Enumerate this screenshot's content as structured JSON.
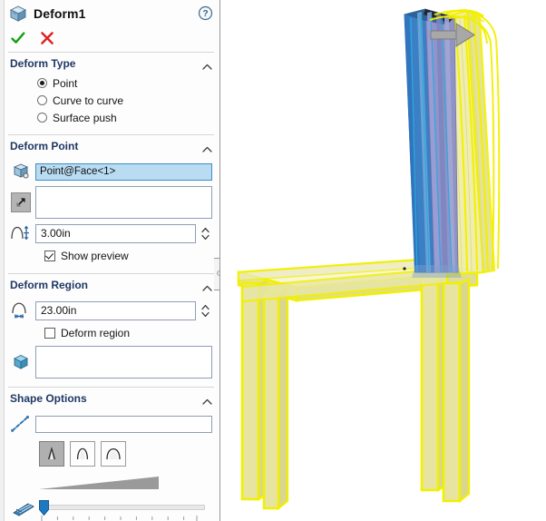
{
  "panel": {
    "title": "Deform1",
    "title_icon": "deform-box-icon",
    "help_icon": "help-question-icon",
    "accept_icon": "green-check-icon",
    "cancel_icon": "red-x-icon",
    "colors": {
      "group_header": "#1f3864",
      "selected_field": "#b9dcf3",
      "accept_green": "#12a012",
      "cancel_red": "#e02020",
      "accent_blue": "#2f74b5"
    }
  },
  "groups": {
    "deform_type": {
      "label": "Deform Type",
      "collapse_icon": "chevron-up-icon",
      "options": [
        {
          "label": "Point",
          "selected": true
        },
        {
          "label": "Curve to curve",
          "selected": false
        },
        {
          "label": "Surface push",
          "selected": false
        }
      ]
    },
    "deform_point": {
      "label": "Deform Point",
      "collapse_icon": "chevron-up-icon",
      "point_icon": "face-point-selection-icon",
      "point_value": "Point@Face<1>",
      "direction_toggle_icon": "deform-direction-arrow-icon",
      "direction_value": "",
      "direction_placeholder": "",
      "distance_icon": "deform-distance-icon",
      "distance_value": "3.00in",
      "spin_icon": "spinner-up-down-icon",
      "show_preview": {
        "label": "Show preview",
        "checked": true
      }
    },
    "deform_region": {
      "label": "Deform Region",
      "collapse_icon": "chevron-up-icon",
      "radius_icon": "deform-radius-icon",
      "radius_value": "23.00in",
      "spin_icon": "spinner-up-down-icon",
      "deform_region_check": {
        "label": "Deform region",
        "checked": false
      },
      "body_icon": "solid-body-cube-icon",
      "body_value": "",
      "body_placeholder": ""
    },
    "shape_options": {
      "label": "Shape Options",
      "collapse_icon": "chevron-up-icon",
      "curve_icon": "shape-curve-dashed-icon",
      "curve_value": "",
      "curve_placeholder": "",
      "shape_buttons": [
        {
          "name": "stiffness-minimum",
          "icon": "peak-narrow-icon",
          "active": true
        },
        {
          "name": "stiffness-medium",
          "icon": "peak-medium-icon",
          "active": false
        },
        {
          "name": "stiffness-maximum",
          "icon": "peak-broad-icon",
          "active": false
        }
      ],
      "wedge_icon": "shape-accuracy-wedge-icon",
      "slider_icon": "shape-accuracy-icon",
      "slider_value": 0,
      "slider_min": 0,
      "slider_max": 100,
      "slider_tick_count": 10
    }
  },
  "splitter": {
    "name": "panel-splitter-handle",
    "dot_icon": "splitter-dot-icon"
  },
  "viewport": {
    "name": "3d-model-viewport",
    "model": "chair-deform-preview",
    "background": "#ffffff",
    "original_wireframe_color": "#f2f000",
    "original_face_color": "#eeeb9a",
    "preview_face_color": "#3b7fc4",
    "preview_shade_color": "#8b8fc8",
    "manipulator_icon": "deform-arrow-handle-icon",
    "manipulator_color": "#a8a8a8"
  }
}
